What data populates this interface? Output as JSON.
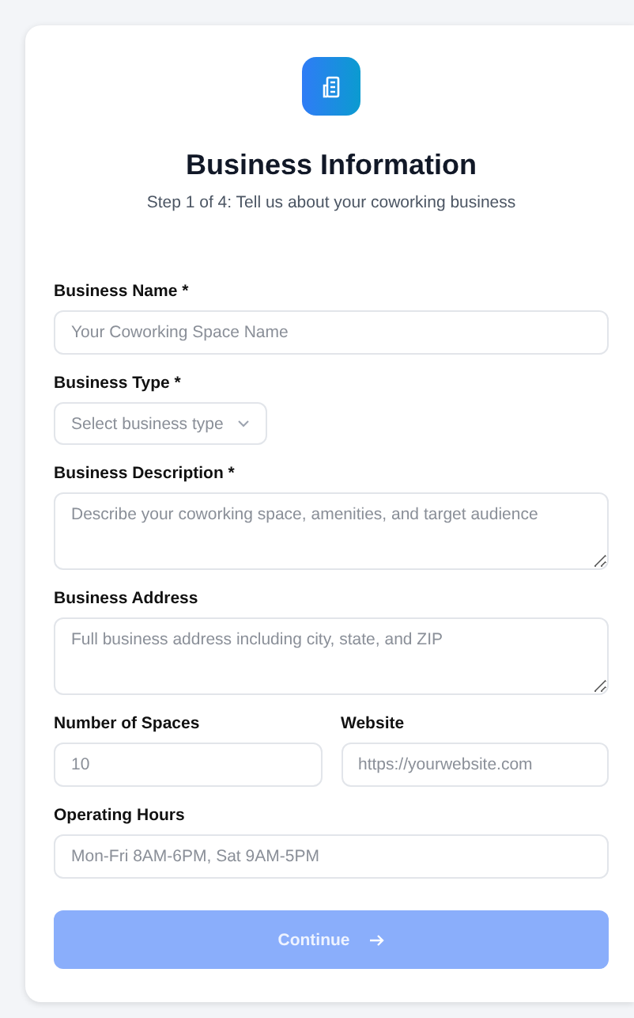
{
  "header": {
    "title": "Business Information",
    "subtitle": "Step 1 of 4: Tell us about your coworking business"
  },
  "rows": [
    [
      {
        "kind": "text",
        "label": "Business Name *",
        "placeholder": "Your Coworking Space Name"
      }
    ],
    [
      {
        "kind": "select",
        "label": "Business Type *",
        "placeholder": "Select business type"
      }
    ],
    [
      {
        "kind": "textarea",
        "label": "Business Description *",
        "placeholder": "Describe your coworking space, amenities, and target audience"
      }
    ],
    [
      {
        "kind": "textarea",
        "label": "Business Address",
        "placeholder": "Full business address including city, state, and ZIP"
      }
    ],
    [
      {
        "kind": "text",
        "label": "Number of Spaces",
        "placeholder": "10"
      },
      {
        "kind": "text",
        "label": "Website",
        "placeholder": "https://yourwebsite.com"
      }
    ],
    [
      {
        "kind": "text",
        "label": "Operating Hours",
        "placeholder": "Mon-Fri 8AM-6PM, Sat 9AM-5PM"
      }
    ]
  ],
  "continue_button": {
    "label": "Continue",
    "disabled": true
  }
}
